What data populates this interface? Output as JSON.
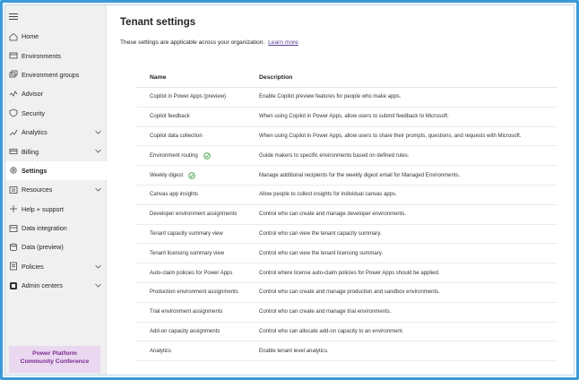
{
  "page": {
    "title": "Tenant settings",
    "subtitle": "These settings are applicable across your organization.",
    "learn_more": "Learn more"
  },
  "sidebar": {
    "items": [
      {
        "label": "Home",
        "icon": "home-icon"
      },
      {
        "label": "Environments",
        "icon": "environments-icon"
      },
      {
        "label": "Environment groups",
        "icon": "environment-groups-icon"
      },
      {
        "label": "Advisor",
        "icon": "advisor-icon"
      },
      {
        "label": "Security",
        "icon": "shield-icon"
      },
      {
        "label": "Analytics",
        "icon": "analytics-icon",
        "expandable": true
      },
      {
        "label": "Billing",
        "icon": "billing-icon",
        "expandable": true
      },
      {
        "label": "Settings",
        "icon": "gear-icon",
        "active": true
      },
      {
        "label": "Resources",
        "icon": "resources-icon",
        "expandable": true
      },
      {
        "label": "Help + support",
        "icon": "help-icon"
      },
      {
        "label": "Data integration",
        "icon": "data-integration-icon"
      },
      {
        "label": "Data (preview)",
        "icon": "data-icon"
      },
      {
        "label": "Policies",
        "icon": "policies-icon",
        "expandable": true
      },
      {
        "label": "Admin centers",
        "icon": "admin-centers-icon",
        "expandable": true
      }
    ],
    "promo_line1": "Power Platform",
    "promo_line2": "Community Conference"
  },
  "table": {
    "headers": {
      "name": "Name",
      "description": "Description"
    },
    "rows": [
      {
        "name": "Copilot in Power Apps (preview)",
        "description": "Enable Copilot preview features for people who make apps.",
        "badge": false
      },
      {
        "name": "Copilot feedback",
        "description": "When using Copilot in Power Apps, allow users to submit feedback to Microsoft.",
        "badge": false
      },
      {
        "name": "Copilot data collection",
        "description": "When using Copilot in Power Apps, allow users to share their prompts, questions, and requests with Microsoft.",
        "badge": false
      },
      {
        "name": "Environment routing",
        "description": "Guide makers to specific environments based on defined rules.",
        "badge": true
      },
      {
        "name": "Weekly digest",
        "description": "Manage additional recipients for the weekly digest email for Managed Environments.",
        "badge": true
      },
      {
        "name": "Canvas app insights",
        "description": "Allow people to collect insights for individual canvas apps.",
        "badge": false
      },
      {
        "name": "Developer environment assignments",
        "description": "Control who can create and manage developer environments.",
        "badge": false
      },
      {
        "name": "Tenant capacity summary view",
        "description": "Control who can view the tenant capacity summary.",
        "badge": false
      },
      {
        "name": "Tenant licensing summary view",
        "description": "Control who can view the tenant licensing summary.",
        "badge": false
      },
      {
        "name": "Auto-claim policies for Power Apps",
        "description": "Control where license auto-claim policies for Power Apps should be applied.",
        "badge": false
      },
      {
        "name": "Production environment assignments",
        "description": "Control who can create and manage production and sandbox environments.",
        "badge": false
      },
      {
        "name": "Trial environment assignments",
        "description": "Control who can create and manage trial environments.",
        "badge": false
      },
      {
        "name": "Add-on capacity assignments",
        "description": "Control who can allocate add-on capacity to an environment.",
        "badge": false
      },
      {
        "name": "Analytics",
        "description": "Enable tenant level analytics.",
        "badge": false
      }
    ]
  },
  "colors": {
    "frame": "#3a9ad9",
    "accent": "#5b3e96",
    "managed_badge": "#3c9d3c"
  }
}
